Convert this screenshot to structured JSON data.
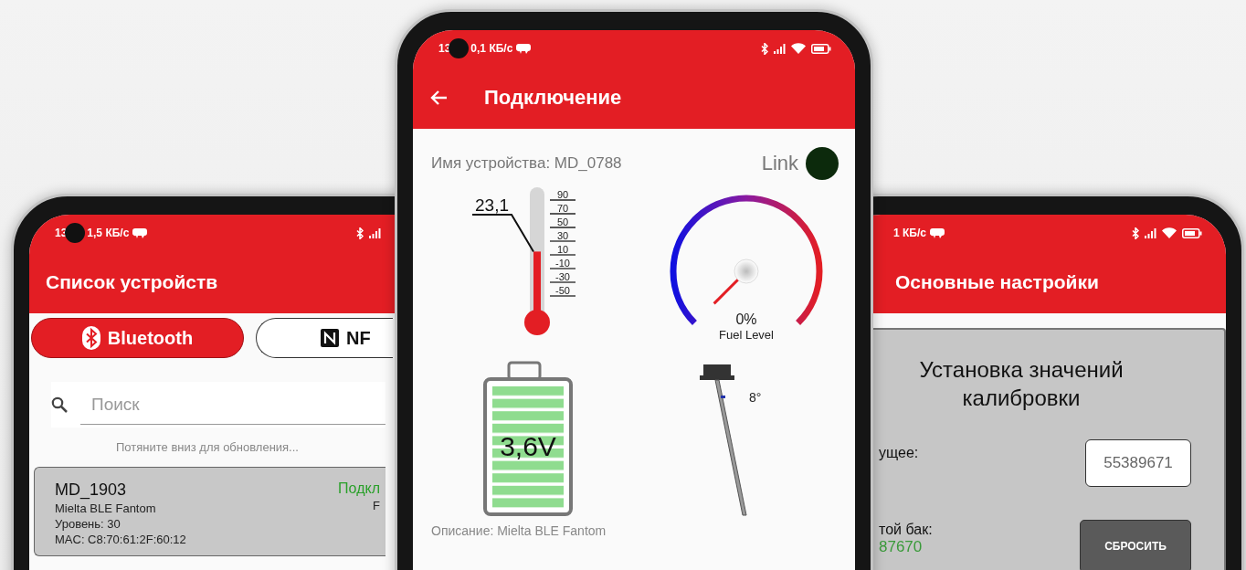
{
  "device_list_screen": {
    "status_bar": {
      "time": "13",
      "speed": "1,5 КБ/с"
    },
    "title": "Список устройств",
    "tabs": [
      {
        "label": "Bluetooth",
        "selected": true,
        "kind": "bluetooth"
      },
      {
        "label": "NF",
        "selected": false,
        "kind": "nfc"
      }
    ],
    "search": {
      "placeholder": "Поиск"
    },
    "hint": "Потяните вниз для обновления...",
    "devices": [
      {
        "name": "MD_1903",
        "model": "Mielta BLE Fantom",
        "level_text": "Уровень: 30",
        "mac": "MAC: C8:70:61:2F:60:12",
        "status": "Подкл",
        "column_2": "F"
      }
    ]
  },
  "connection_screen": {
    "status_bar": {
      "time": "13",
      "speed": "0,1 КБ/с"
    },
    "title": "Подключение",
    "device_name": "Имя устройства: MD_0788",
    "link_label": "Link",
    "thermometer": {
      "reading": "23,1",
      "scale": [
        "90",
        "70",
        "50",
        "30",
        "10",
        "-10",
        "-30",
        "-50"
      ],
      "level": 0.52
    },
    "fuel_gauge": {
      "reading": "0%",
      "label": "Fuel Level"
    },
    "battery": {
      "reading": "3,6V",
      "level": 1
    },
    "probe": {
      "reading": "8°"
    },
    "description": "Описание: Mielta BLE Fantom"
  },
  "settings_screen": {
    "status_bar": {
      "speed": "1 КБ/с"
    },
    "title": "Основные настройки",
    "panel": {
      "heading": "Установка значений калибровки",
      "current_label": "ущее:",
      "current_value": "55389671",
      "empty_tank_label": "той бак:",
      "empty_tank_value": "87670",
      "reset_button": "СБРОСИТЬ"
    }
  }
}
